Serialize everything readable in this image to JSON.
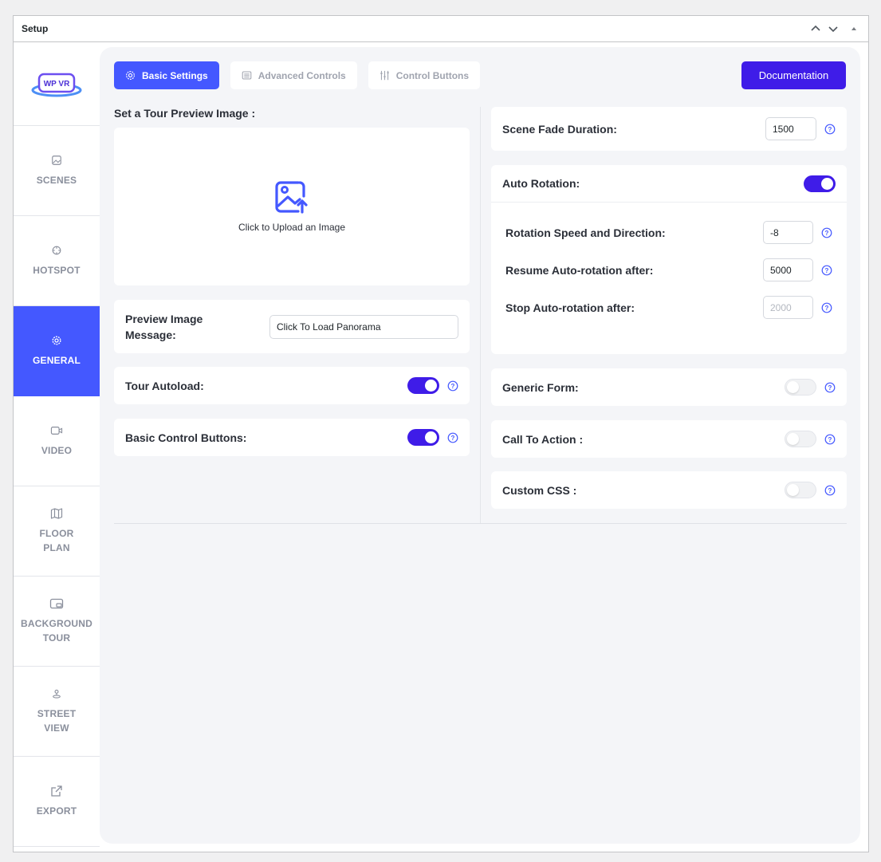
{
  "metabox": {
    "title": "Setup"
  },
  "logo": {
    "text": "WP VR"
  },
  "nav": [
    {
      "key": "scenes",
      "label": "SCENES",
      "icon": "image-icon",
      "active": false
    },
    {
      "key": "hotspot",
      "label": "HOTSPOT",
      "icon": "crosshair-icon",
      "active": false
    },
    {
      "key": "general",
      "label": "GENERAL",
      "icon": "gear-icon",
      "active": true
    },
    {
      "key": "video",
      "label": "VIDEO",
      "icon": "video-icon",
      "active": false
    },
    {
      "key": "floor-plan",
      "label": "FLOOR\nPLAN",
      "icon": "map-icon",
      "active": false
    },
    {
      "key": "background-tour",
      "label": "BACKGROUND\nTOUR",
      "icon": "picture-in-picture-icon",
      "active": false
    },
    {
      "key": "street-view",
      "label": "STREET\nVIEW",
      "icon": "person-pin-icon",
      "active": false
    },
    {
      "key": "export",
      "label": "EXPORT",
      "icon": "external-link-icon",
      "active": false
    }
  ],
  "tabs": [
    {
      "label": "Basic Settings",
      "icon": "gear-icon",
      "active": true
    },
    {
      "label": "Advanced Controls",
      "icon": "list-icon",
      "active": false
    },
    {
      "label": "Control Buttons",
      "icon": "sliders-icon",
      "active": false
    }
  ],
  "documentation_label": "Documentation",
  "left": {
    "preview_title": "Set a Tour Preview Image :",
    "upload_text": "Click to Upload an Image",
    "preview_message_label": "Preview Image\nMessage:",
    "preview_message_value": "Click To Load Panorama",
    "tour_autoload_label": "Tour Autoload:",
    "tour_autoload_on": true,
    "basic_controls_label": "Basic Control Buttons:",
    "basic_controls_on": true
  },
  "right": {
    "scene_fade_label": "Scene Fade Duration:",
    "scene_fade_value": "1500",
    "auto_rotation_label": "Auto Rotation:",
    "auto_rotation_on": true,
    "rotation_speed_label": "Rotation Speed and Direction:",
    "rotation_speed_value": "-8",
    "resume_label": "Resume Auto-rotation after:",
    "resume_value": "5000",
    "stop_label": "Stop Auto-rotation after:",
    "stop_placeholder": "2000",
    "generic_form_label": "Generic Form:",
    "generic_form_on": false,
    "cta_label": "Call To Action :",
    "cta_on": false,
    "custom_css_label": "Custom CSS :",
    "custom_css_on": false
  },
  "colors": {
    "accent": "#4458ff",
    "primary": "#3f1ce8",
    "panel": "#f4f5f8"
  }
}
